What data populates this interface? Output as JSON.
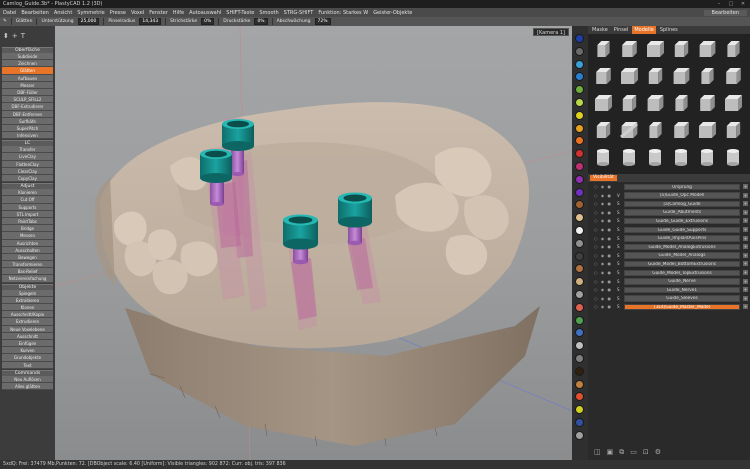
{
  "title": "Camlog_Guide.3b* - PlastyCAD 1.2 (3D)",
  "menu": [
    "Datei",
    "Bearbeiten",
    "Ansicht",
    "Symmetrie",
    "Presse",
    "Voxel",
    "Fenster",
    "Hilfe",
    "Autoauswahl",
    "SHIFT-Taste",
    "Smooth",
    "STRG-SHIFT",
    "Funktion: Starkes W",
    "Geister-Objekte",
    "Bearbeiten"
  ],
  "toolbar": {
    "items": [
      {
        "label": "Glätten",
        "value": ""
      },
      {
        "label": "Unterstützung",
        "value": "25,000"
      },
      {
        "label": "Pinselradius",
        "value": "14,343"
      },
      {
        "label": "Strichstärke",
        "value": "0%"
      },
      {
        "label": "Druckstärke",
        "value": "0%"
      },
      {
        "label": "Abschwächung",
        "value": "72%"
      }
    ]
  },
  "left": {
    "sections": [
      {
        "title": "Oberfläche",
        "items": [
          {
            "label": "Subdivide"
          },
          {
            "label": "Zeichnen"
          },
          {
            "label": "Glätten",
            "active": true
          },
          {
            "label": "Aufbauen"
          },
          {
            "label": "Messer"
          },
          {
            "label": "DBF-Füller"
          },
          {
            "label": "SCULP_SFILL2"
          },
          {
            "label": "DBF-Extrudierer"
          },
          {
            "label": "DBF-Entfernen"
          },
          {
            "label": "Surfkäfe"
          },
          {
            "label": "SuperPitch"
          },
          {
            "label": "Infensiven"
          }
        ]
      },
      {
        "title": "LC",
        "items": [
          {
            "label": "Transfer"
          },
          {
            "label": "LiveClay"
          },
          {
            "label": "FlattenClay"
          },
          {
            "label": "ClearClay"
          },
          {
            "label": "CopyClay"
          }
        ]
      },
      {
        "title": "Adjust",
        "items": [
          {
            "label": "Klonieren"
          },
          {
            "label": "Cut Off"
          },
          {
            "label": "Supports"
          },
          {
            "label": "STL Import"
          },
          {
            "label": "PaintTabs"
          },
          {
            "label": "Bridge"
          },
          {
            "label": "Messen"
          },
          {
            "label": "Ausrichten"
          },
          {
            "label": "Ausschalten"
          },
          {
            "label": "Bewegen"
          },
          {
            "label": "Transformieren"
          },
          {
            "label": "Bas-Relief"
          },
          {
            "label": "Netzvereinfachung"
          }
        ]
      },
      {
        "title": "Objekte",
        "items": [
          {
            "label": "Spiegeln"
          },
          {
            "label": "Extrahieren"
          },
          {
            "label": "Klonen"
          },
          {
            "label": "Ausschnitt/Kopie"
          },
          {
            "label": "Extrudieren"
          },
          {
            "label": "Neue Voxelebene"
          },
          {
            "label": "Ausschnitt"
          },
          {
            "label": "Einfügen"
          },
          {
            "label": "Kurven"
          },
          {
            "label": "Grundobjekte"
          },
          {
            "label": "Text"
          }
        ]
      },
      {
        "title": "Commands",
        "items": [
          {
            "label": "Neu Auflösen"
          },
          {
            "label": "Alles glätten"
          }
        ]
      }
    ]
  },
  "viewport": {
    "camera": "[Kamera 1]"
  },
  "right": {
    "tabs": [
      {
        "label": "Maske"
      },
      {
        "label": "Pinsel"
      },
      {
        "label": "Modelle",
        "active": true
      },
      {
        "label": "Splines"
      }
    ],
    "visibility_label": "Visibilität",
    "layers": [
      {
        "name": "Ursprung",
        "ctl": ""
      },
      {
        "name": "[a]Guide_Opc Modell",
        "ctl": "V"
      },
      {
        "name": "[a]Camlog_Guide",
        "ctl": "S"
      },
      {
        "name": "Guide_Abutments",
        "ctl": "S"
      },
      {
        "name": "Guide_Guide_Extrusions",
        "ctl": "S"
      },
      {
        "name": "Guide_Guide_Supports",
        "ctl": "S"
      },
      {
        "name": "Guide_ImplantAxisPins",
        "ctl": "S"
      },
      {
        "name": "Guide_Model_AnalogExtrusions",
        "ctl": "S"
      },
      {
        "name": "Guide_Model_Analogs",
        "ctl": "S"
      },
      {
        "name": "Guide_Model_BottomExtrusions",
        "ctl": "S"
      },
      {
        "name": "Guide_Model_TopExtrusions",
        "ctl": "S"
      },
      {
        "name": "Guide_Nerve",
        "ctl": "S"
      },
      {
        "name": "Guide_Nerve1",
        "ctl": "S"
      },
      {
        "name": "Guide_Sleeves",
        "ctl": "S"
      },
      {
        "name": "[3L4]Guide_Master_Model",
        "ctl": "S",
        "selected": true
      }
    ]
  },
  "palette_colors": [
    "#1f3fa8",
    "#6a6a6a",
    "#3aa0d8",
    "#2a7fd0",
    "#6fae3c",
    "#b8d84a",
    "#e0d020",
    "#e8a020",
    "#e87020",
    "#d03030",
    "#c03070",
    "#9030b0",
    "#7030c0",
    "#a06030",
    "#e0c090",
    "#f0f0f0",
    "#909090",
    "#404040",
    "#b07040",
    "#d0b080",
    "#a0a0a0",
    "#e06050",
    "#50a050",
    "#4070c0",
    "#c0c0c0",
    "#808080",
    "#302010",
    "#c08040",
    "#e05030",
    "#d0d020",
    "#3050a0",
    "#a0a0a0"
  ],
  "status": "5xdQ:  Frei: 37479 Mb,Punkten: 72. [DBObject scale: 6.40 [Uniform]: Visible triangles: 902 872: Curr. obj. tris: 397 836"
}
